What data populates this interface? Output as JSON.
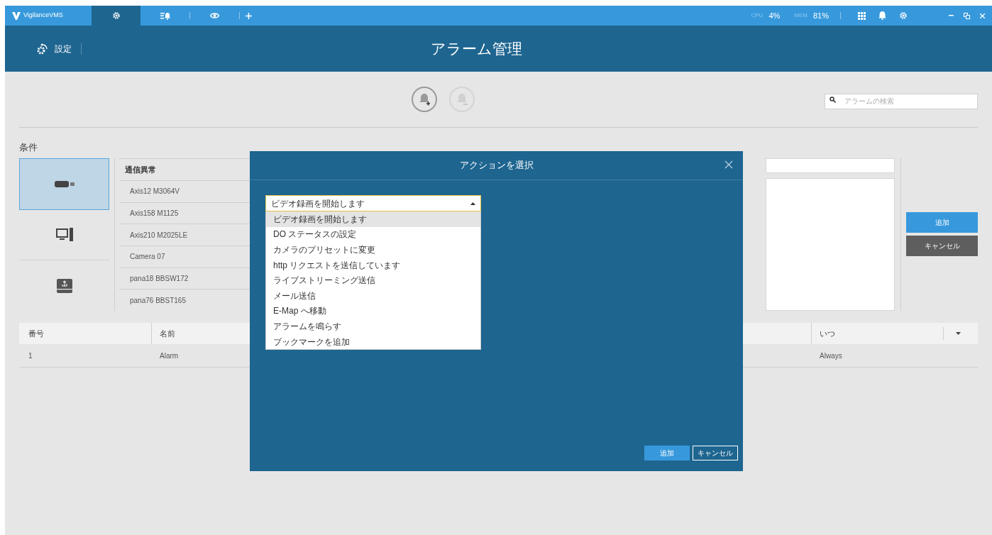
{
  "titlebar": {
    "app_name": "VigilanceVMS",
    "tabs": [
      {
        "kind": "settings",
        "selected": true
      },
      {
        "kind": "alarm-list",
        "selected": false
      },
      {
        "kind": "view",
        "selected": false
      },
      {
        "kind": "add",
        "selected": false
      }
    ],
    "cpu_label": "CPU",
    "cpu": "4%",
    "mem_label": "MEM",
    "mem": "81%"
  },
  "header": {
    "back_label": "設定",
    "title": "アラーム管理"
  },
  "search": {
    "placeholder": "アラームの検索"
  },
  "conditions": {
    "label": "条件",
    "categories": [
      {
        "kind": "camera",
        "selected": true
      },
      {
        "kind": "computer",
        "selected": false
      },
      {
        "kind": "storage",
        "selected": false
      }
    ],
    "group": "通信異常",
    "devices": [
      "Axis12 M3064V",
      "Axis158 M1125",
      "Axis210 M2025LE",
      "Camera 07",
      "pana18 BBSW172",
      "pana76 BBST165"
    ]
  },
  "side_buttons": [
    {
      "kind": "primary",
      "label": "追加"
    },
    {
      "kind": "secondary",
      "label": "キャンセル"
    }
  ],
  "table": {
    "columns": [
      "番号",
      "名前",
      "いつ"
    ],
    "rows": [
      {
        "cells": [
          "1",
          "Alarm",
          "Always"
        ]
      }
    ]
  },
  "dialog": {
    "title": "アクションを選択",
    "dropdown": {
      "value": "ビデオ録画を開始します",
      "expanded": true,
      "options": [
        {
          "label": "ビデオ録画を開始します",
          "selected": true
        },
        {
          "label": "DO ステータスの設定",
          "selected": false
        },
        {
          "label": "カメラのプリセットに変更",
          "selected": false
        },
        {
          "label": "http リクエストを送信しています",
          "selected": false
        },
        {
          "label": "ライブストリーミング送信",
          "selected": false
        },
        {
          "label": "メール送信",
          "selected": false
        },
        {
          "label": "E-Map へ移動",
          "selected": false
        },
        {
          "label": "アラームを鳴らす",
          "selected": false
        },
        {
          "label": "ブックマークを追加",
          "selected": false
        }
      ]
    },
    "buttons": [
      {
        "kind": "primary",
        "label": "追加"
      },
      {
        "kind": "outline",
        "label": "キャンセル"
      }
    ]
  }
}
